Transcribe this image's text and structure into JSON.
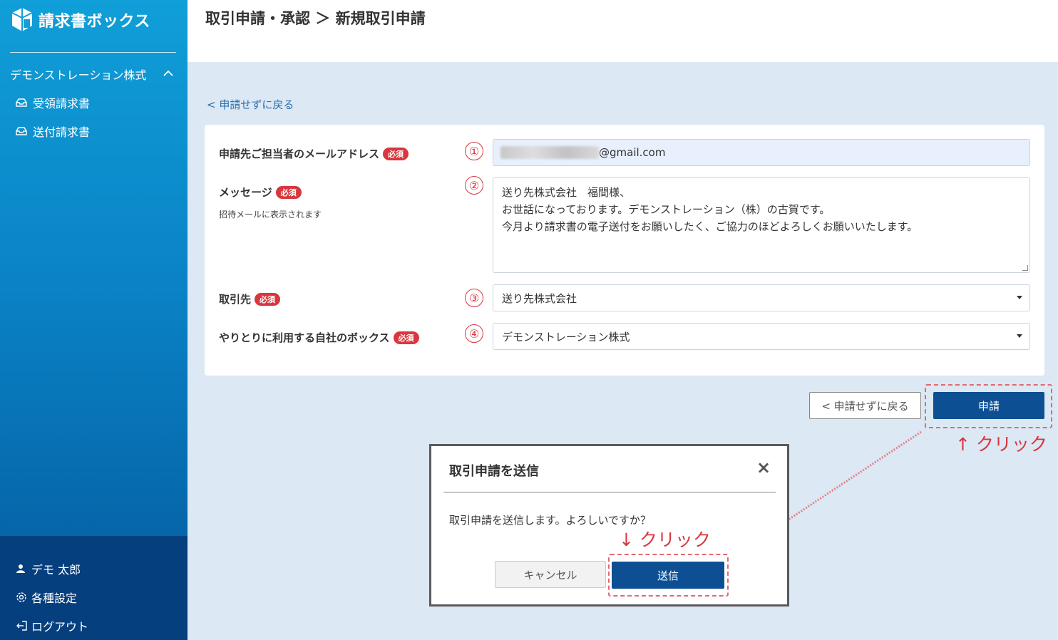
{
  "app": {
    "name": "請求書ボックス"
  },
  "sidebar": {
    "company": "デモンストレーション株式",
    "items": [
      {
        "label": "受領請求書"
      },
      {
        "label": "送付請求書"
      }
    ],
    "bottom": [
      {
        "label": "デモ 太郎"
      },
      {
        "label": "各種設定"
      },
      {
        "label": "ログアウト"
      }
    ]
  },
  "header": {
    "title": "取引申請・承認 ＞ 新規取引申請"
  },
  "back_link": "< 申請せずに戻る",
  "form": {
    "required_badge": "必須",
    "fields": [
      {
        "number": "①",
        "label": "申請先ご担当者のメールアドレス",
        "value_suffix": "@gmail.com"
      },
      {
        "number": "②",
        "label": "メッセージ",
        "hint": "招待メールに表示されます",
        "lines": [
          "送り先株式会社　福間様、",
          "お世話になっております。デモンストレーション（株）の古賀です。",
          "今月より請求書の電子送付をお願いしたく、ご協力のほどよろしくお願いいたします。"
        ]
      },
      {
        "number": "③",
        "label": "取引先",
        "value": "送り先株式会社"
      },
      {
        "number": "④",
        "label": "やりとりに利用する自社のボックス",
        "value": "デモンストレーション株式"
      }
    ]
  },
  "actions": {
    "back_label": "< 申請せずに戻る",
    "apply_label": "申請"
  },
  "annotations": {
    "click_up": "↑ クリック",
    "click_down": "↓ クリック"
  },
  "modal": {
    "title": "取引申請を送信",
    "close": "×",
    "body": "取引申請を送信します。よろしいですか？",
    "cancel_label": "キャンセル",
    "send_label": "送信"
  },
  "colors": {
    "primary": "#0d4f93",
    "accent_red": "#d9363e",
    "sidebar": "#0a82c5"
  }
}
